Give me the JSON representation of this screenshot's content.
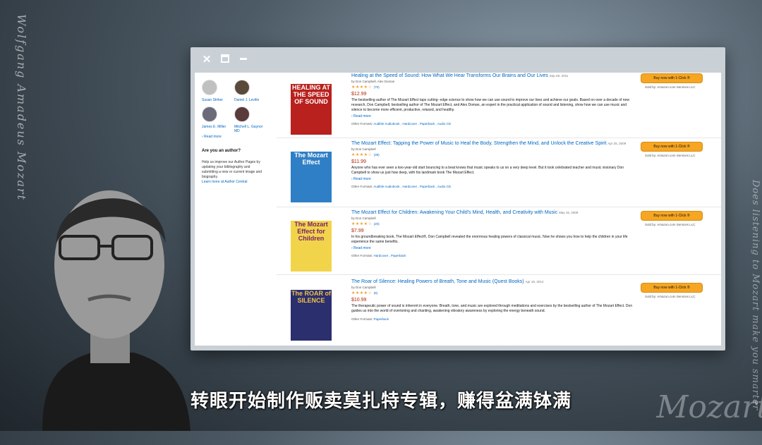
{
  "background": {
    "left_vertical": "Wolfgang Amadeus Mozart",
    "right_vertical": "Does listening to Mozart make you smarter",
    "signature": "Mozart"
  },
  "window": {
    "close_icon": "close-icon",
    "maximize_icon": "maximize-icon",
    "minimize_icon": "minimize-icon"
  },
  "sidebar": {
    "authors": [
      {
        "name": "Susan Striker"
      },
      {
        "name": "Daniel J. Levitin"
      },
      {
        "name": "James E. Miller"
      },
      {
        "name": "Mitchell L. Gaynor MD"
      }
    ],
    "read_more": "‹ Read more",
    "ask_title": "Are you an author?",
    "help_text": "Help us improve our Author Pages by updating your bibliography and submitting a new or current image and biography.",
    "help_link": "Learn more at Author Central"
  },
  "results": [
    {
      "title": "Healing at the Speed of Sound: How What We Hear Transforms Our Brains and Our Lives",
      "date": "Sep 29, 2011",
      "by": "by Don Campbell, Alex Doman",
      "rating_count": "70",
      "price": "$12.99",
      "description": "The bestselling author of The Mozart Effect taps cutting- edge science to show how we can use sound to improve our lives and achieve our goals. Based on over a decade of new research, Don Campbell, bestselling author of The Mozart Effect, and Alex Doman, an expert in the practical application of sound and listening, show how we can use music and silence to become more efficient, productive, relaxed, and healthy.",
      "read_more": "› Read more",
      "other_formats_label": "Other Formats:",
      "other_formats": "Audible Audiobook , Hardcover , Paperback , Audio CD",
      "buy_label": "Buy now with 1-Click ®",
      "sold_by": "Sold by: Amazon.com Services LLC",
      "cover_text": "HEALING AT THE SPEED OF SOUND",
      "cover_color": "#b8211d"
    },
    {
      "title": "The Mozart Effect: Tapping the Power of Music to Heal the Body, Strengthen the Mind, and Unlock the Creative Spirit",
      "date": "Apr 25, 2009",
      "by": "by Don Campbell",
      "rating_count": "38",
      "price": "$11.99",
      "description": "Anyone who has ever seen a two-year-old start bouncing to a beat knows that music speaks to us on a very deep level. But it took celebrated teacher and music visionary Don Campbell to show us just how deep, with his landmark book The Mozart Effect.",
      "read_more": "› Read more",
      "other_formats_label": "Other Formats:",
      "other_formats": "Audible Audiobook , Hardcover , Paperback , Audio CD",
      "buy_label": "Buy now with 1-Click ®",
      "sold_by": "Sold by: Amazon.com Services LLC",
      "cover_text": "The Mozart Effect",
      "cover_color": "#2f7fc6"
    },
    {
      "title": "The Mozart Effect for Children: Awakening Your Child's Mind, Health, and Creativity with Music",
      "date": "May 15, 2009",
      "by": "by Don Campbell",
      "rating_count": "20",
      "price": "$7.99",
      "description": "In his groundbreaking book, The Mozart Effect®, Don Campbell revealed the enormous healing powers of classical music. Now he shows you how to help the children in your life experience the same benefits.",
      "read_more": "› Read more",
      "other_formats_label": "Other Formats:",
      "other_formats": "Hardcover , Paperback",
      "buy_label": "Buy now with 1-Click ®",
      "sold_by": "Sold by: Amazon.com Services LLC",
      "cover_text": "The Mozart Effect for Children",
      "cover_color": "#f2d44a"
    },
    {
      "title": "The Roar of Silence: Healing Powers of Breath, Tone and Music (Quest Books)",
      "date": "Apr 18, 2014",
      "by": "by Don Campbell",
      "rating_count": "9",
      "price": "$10.99",
      "description": "The therapeutic power of sound is inherent in everyone. Breath, tone, and music are explored through meditations and exercises by the bestselling author of The Mozart Effect. Don guides us into the world of overtoning and chanting, awakening vibratory awareness by exploring the energy beneath sound.",
      "read_more": "",
      "other_formats_label": "Other Formats:",
      "other_formats": "Paperback",
      "buy_label": "Buy now with 1-Click ®",
      "sold_by": "Sold by: Amazon.com Services LLC",
      "cover_text": "The ROAR of SILENCE",
      "cover_color": "#2b2f6e"
    }
  ],
  "subtitle": "转眼开始制作贩卖莫扎特专辑，赚得盆满钵满",
  "colors": {
    "link": "#0066c0",
    "price": "#b12704",
    "buy_button": "#f6a623",
    "stars": "#f0a02c"
  }
}
